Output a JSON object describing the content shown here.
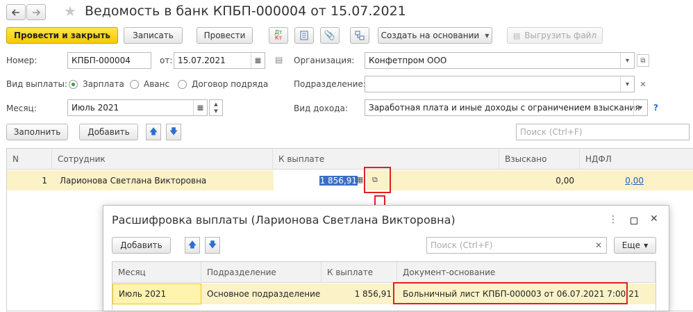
{
  "window": {
    "title": "Ведомость в банк КПБП-000004 от 15.07.2021",
    "back_icon": "arrow-left-icon",
    "forward_icon": "arrow-right-icon",
    "favorite_icon": "star-icon"
  },
  "toolbar": {
    "post_close": "Провести и закрыть",
    "save": "Записать",
    "post": "Провести",
    "dt_kt_top": "Дт",
    "dt_kt_bottom": "Кт",
    "create_based": "Создать на основании",
    "export": "Выгрузить файл"
  },
  "form": {
    "number_label": "Номер:",
    "number_value": "КПБП-000004",
    "date_label": "от:",
    "date_value": "15.07.2021",
    "org_label": "Организация:",
    "org_value": "Конфетпром ООО",
    "payment_type_label": "Вид выплаты:",
    "payment_types": [
      "Зарплата",
      "Аванс",
      "Договор подряда"
    ],
    "payment_type_selected": "Зарплата",
    "department_label": "Подразделение:",
    "department_value": "",
    "month_label": "Месяц:",
    "month_value": "Июль 2021",
    "income_label": "Вид дохода:",
    "income_value": "Заработная плата и иные доходы с ограничением взыскания",
    "help": "?"
  },
  "table_toolbar": {
    "fill": "Заполнить",
    "add": "Добавить",
    "search_placeholder": "Поиск (Ctrl+F)"
  },
  "table": {
    "columns": [
      "N",
      "Сотрудник",
      "К выплате",
      "Взыскано",
      "НДФЛ"
    ],
    "rows": [
      {
        "n": "1",
        "employee": "Ларионова Светлана Викторовна",
        "to_pay": "1 856,91",
        "collected": "0,00",
        "ndfl": "0,00"
      }
    ]
  },
  "dialog": {
    "title": "Расшифровка выплаты (Ларионова Светлана Викторовна)",
    "add": "Добавить",
    "search_placeholder": "Поиск (Ctrl+F)",
    "more": "Еще",
    "columns": [
      "Месяц",
      "Подразделение",
      "К выплате",
      "Документ-основание"
    ],
    "rows": [
      {
        "month": "Июль 2021",
        "department": "Основное подразделение",
        "to_pay": "1 856,91",
        "document": "Больничный лист КПБП-000003 от 06.07.2021 7:00:21"
      }
    ]
  },
  "colors": {
    "accent_yellow": "#f6c900",
    "selection_row": "#fbf2c8",
    "highlight_red": "#e02020",
    "link_blue": "#1f5fbf"
  }
}
